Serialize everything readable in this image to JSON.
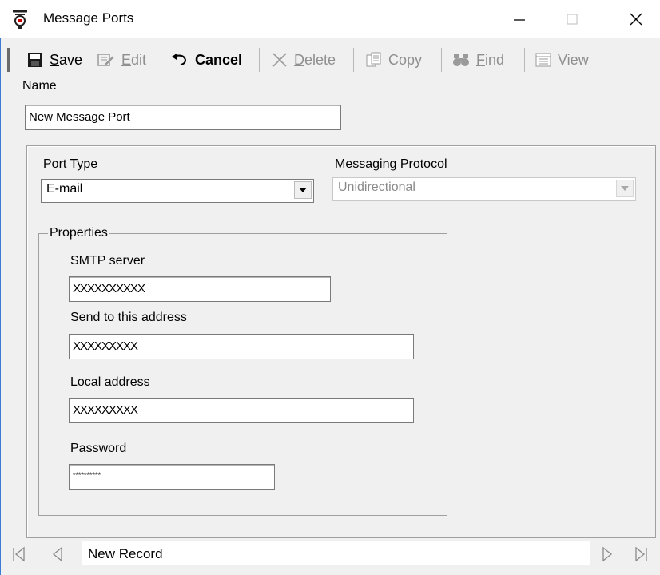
{
  "window": {
    "title": "Message Ports"
  },
  "toolbar": {
    "save": {
      "prefix": "",
      "hotkey": "S",
      "rest": "ave"
    },
    "edit": {
      "hotkey": "E",
      "rest": "dit"
    },
    "cancel": "Cancel",
    "delete": {
      "hotkey": "D",
      "rest": "elete"
    },
    "copy": "Copy",
    "find": {
      "hotkey": "F",
      "rest": "ind"
    },
    "view": "View"
  },
  "form": {
    "name_label": "Name",
    "name_value": "New Message Port",
    "port_type_label": "Port Type",
    "port_type_value": "E-mail",
    "protocol_label": "Messaging Protocol",
    "protocol_value": "Unidirectional",
    "properties_label": "Properties",
    "smtp_label": "SMTP server",
    "smtp_value": "XXXXXXXXXX",
    "send_to_label": "Send to this address",
    "send_to_value": "XXXXXXXXX",
    "local_label": "Local address",
    "local_value": "XXXXXXXXX",
    "password_label": "Password",
    "password_value": "**********"
  },
  "navigation": {
    "record_status": "New Record"
  }
}
